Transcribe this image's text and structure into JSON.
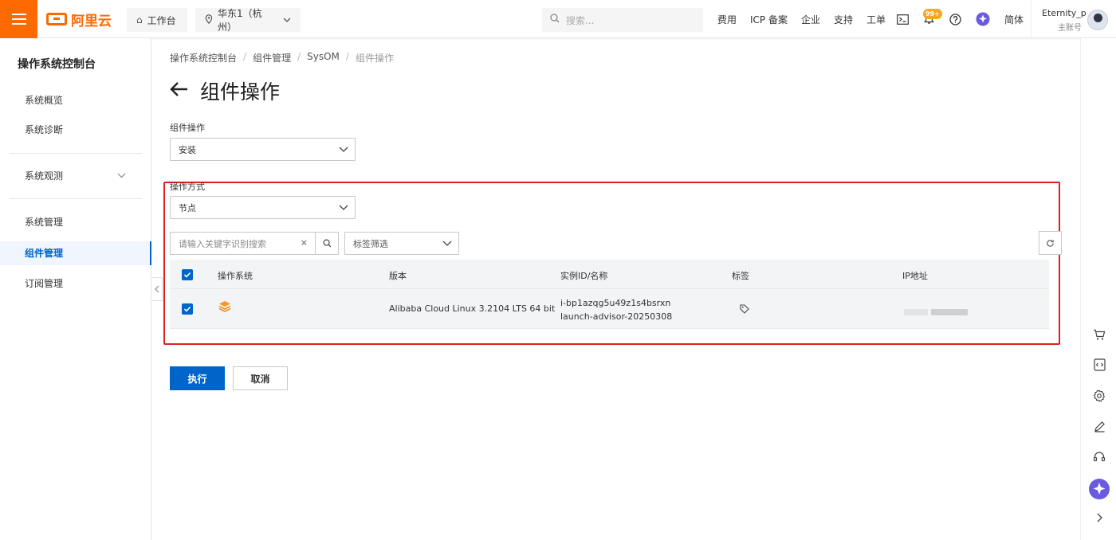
{
  "header": {
    "logo_text": "阿里云",
    "workbench": "工作台",
    "region": "华东1（杭州）",
    "search_placeholder": "搜索...",
    "nav_links": [
      "费用",
      "ICP 备案",
      "企业",
      "支持",
      "工单"
    ],
    "notification_badge": "99+",
    "language": "简体",
    "user_name": "Eternity_p",
    "user_role": "主账号"
  },
  "sidebar": {
    "title": "操作系统控制台",
    "items": [
      {
        "label": "系统概览"
      },
      {
        "label": "系统诊断"
      },
      {
        "label": "系统观测"
      },
      {
        "label": "系统管理"
      },
      {
        "label": "组件管理"
      },
      {
        "label": "订阅管理"
      }
    ],
    "active": "组件管理"
  },
  "breadcrumb": [
    "操作系统控制台",
    "组件管理",
    "SysOM",
    "组件操作"
  ],
  "page_title": "组件操作",
  "form": {
    "component_op_label": "组件操作",
    "component_op_value": "安装",
    "op_mode_label": "操作方式",
    "op_mode_value": "节点",
    "keyword_placeholder": "请输入关键字识别搜索",
    "tag_filter_placeholder": "标签筛选"
  },
  "table": {
    "columns": [
      "操作系统",
      "版本",
      "实例ID/名称",
      "标签",
      "IP地址"
    ],
    "rows": [
      {
        "checked": true,
        "version": "Alibaba Cloud Linux  3.2104 LTS 64 bit",
        "instance_id": "i-bp1azqg5u49z1s4bsrxn",
        "instance_name": "launch-advisor-20250308"
      }
    ]
  },
  "actions": {
    "execute": "执行",
    "cancel": "取消"
  },
  "colors": {
    "brand": "#ff6a00",
    "primary": "#0064c8",
    "highlight_border": "#e02020"
  }
}
